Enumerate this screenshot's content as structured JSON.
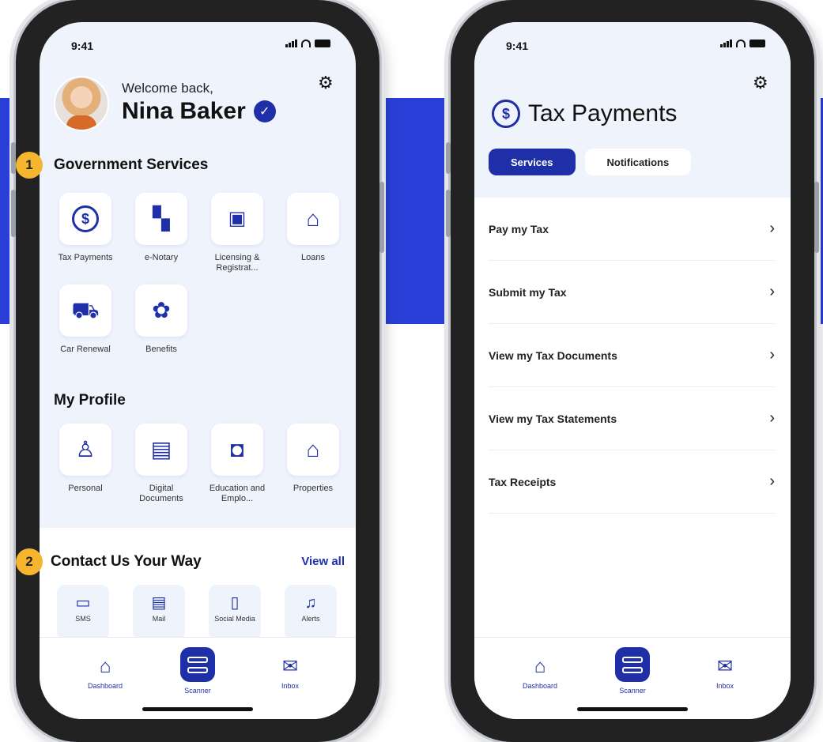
{
  "status_bar": {
    "time": "9:41"
  },
  "badges": [
    "1",
    "2"
  ],
  "left_screen": {
    "welcome": "Welcome back,",
    "user_name": "Nina Baker",
    "gov_services": {
      "title": "Government Services",
      "items": [
        {
          "label": "Tax Payments",
          "icon": "dollar-circle-icon"
        },
        {
          "label": "e-Notary",
          "icon": "notary-document-icon"
        },
        {
          "label": "Licensing & Registrat...",
          "icon": "id-card-icon"
        },
        {
          "label": "Loans",
          "icon": "bank-icon"
        },
        {
          "label": "Car Renewal",
          "icon": "car-icon"
        },
        {
          "label": "Benefits",
          "icon": "award-ribbon-icon"
        }
      ]
    },
    "my_profile": {
      "title": "My Profile",
      "items": [
        {
          "label": "Personal",
          "icon": "person-icon"
        },
        {
          "label": "Digital Documents",
          "icon": "document-icon"
        },
        {
          "label": "Education and Emplo...",
          "icon": "briefcase-icon"
        },
        {
          "label": "Properties",
          "icon": "house-icon"
        }
      ]
    },
    "contact": {
      "title": "Contact Us Your Way",
      "view_all": "View all",
      "items": [
        {
          "label": "SMS",
          "icon": "chat-bubble-icon"
        },
        {
          "label": "Mail",
          "icon": "mail-card-icon"
        },
        {
          "label": "Social Media",
          "icon": "phone-icon"
        },
        {
          "label": "Alerts",
          "icon": "bell-icon"
        }
      ]
    }
  },
  "right_screen": {
    "title": "Tax Payments",
    "tabs": [
      {
        "label": "Services",
        "active": true
      },
      {
        "label": "Notifications",
        "active": false
      }
    ],
    "list": [
      {
        "label": "Pay my Tax"
      },
      {
        "label": "Submit my Tax"
      },
      {
        "label": "View my Tax Documents"
      },
      {
        "label": "View my Tax Statements"
      },
      {
        "label": "Tax Receipts"
      }
    ]
  },
  "bottom_nav": {
    "dashboard": "Dashboard",
    "scanner": "Scanner",
    "inbox": "Inbox"
  },
  "colors": {
    "accent": "#1f2fa8",
    "band": "#2a3fd8",
    "badge": "#f5b52e",
    "background": "#eef3fc"
  }
}
